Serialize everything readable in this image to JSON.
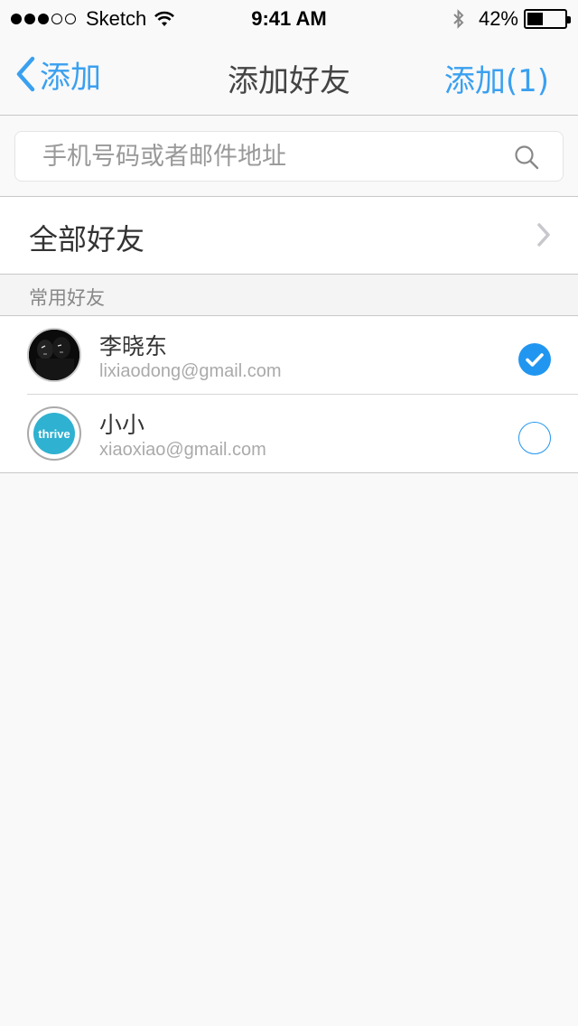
{
  "status_bar": {
    "carrier": "Sketch",
    "time": "9:41 AM",
    "battery_text": "42%",
    "battery_level": 0.42
  },
  "nav": {
    "back_label": "添加",
    "title": "添加好友",
    "action_label": "添加(1)"
  },
  "search": {
    "placeholder": "手机号码或者邮件地址",
    "value": ""
  },
  "all_friends": {
    "label": "全部好友"
  },
  "section": {
    "title": "常用好友"
  },
  "friends": [
    {
      "name": "李晓东",
      "email": "lixiaodong@gmail.com",
      "selected": true,
      "avatar": "dark-photo"
    },
    {
      "name": "小小",
      "email": "xiaoxiao@gmail.com",
      "selected": false,
      "avatar": "thrive-logo",
      "avatar_text": "thrive"
    }
  ],
  "colors": {
    "accent": "#3aa0f0",
    "check": "#2196f0",
    "background": "#f9f9f9"
  }
}
